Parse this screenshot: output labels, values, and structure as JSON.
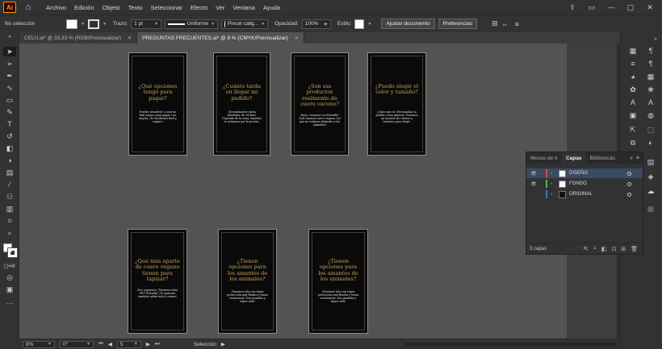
{
  "app": {
    "logo": "Ai",
    "home_icon": "home-icon"
  },
  "menu": [
    "Archivo",
    "Edición",
    "Objeto",
    "Texto",
    "Seleccionar",
    "Efecto",
    "Ver",
    "Ventana",
    "Ayuda"
  ],
  "control_bar": {
    "selection_status": "No selección",
    "stroke_label": "Trazo:",
    "stroke_weight": "1 pt",
    "stroke_profile": "Uniforme",
    "brush": "Pincel calig...",
    "opacity_label": "Opacidad:",
    "opacity_value": "100%",
    "style_label": "Estilo:",
    "adjust_doc_button": "Ajustar documento",
    "preferences_button": "Preferencias"
  },
  "tabs": [
    {
      "label": "CELU.ai* @ 33,33 % (RGB/Previsualizar)",
      "active": false
    },
    {
      "label": "PREGUNTAS FRECUENTES.ai* @ 8 % (CMYK/Previsualizar)",
      "active": true
    }
  ],
  "artboards": [
    {
      "question": "¿Qué opciones tengo para pagar?",
      "answer": "Puedes transferir o usar un link seguro para pagar con tarjeta. ¡Es facilísimo fácil y seguro!"
    },
    {
      "question": "¿Cuánto tarda en llegar mi pedido?",
      "answer": "¡Normalmente tarda alrededor de 24 días! Depende de la zona, también te avisamos por la prensa."
    },
    {
      "question": "¿Son sus productos realmente de cuero vacuno?",
      "answer": "Hoyo, tenemos eco-friendly! Solo usamos cuero vegano, así que no estamos dañando a los animales!"
    },
    {
      "question": "¿Puedo elegir el color y tamaño?",
      "answer": "¡Claro que sí! ¡Personaliza tu pedido como quieras! Tenemos un montón de colores y tamaños para elegir."
    },
    {
      "question": "¿Qué más aparte de cuero vegano tienen para tapizar?",
      "answer": "¡Por supuesto! ¡Tenemos telas PET Friendly! ¡Te gustaría también saber más y vemos!"
    },
    {
      "question": "¿Tienen opciones para los amantes de los animales?",
      "answer": "¡Tenemos tela con súper protección anti-fluidos y tenaz resistencia! Dos grandes y súper vida!"
    },
    {
      "question": "¿Tienen opciones para los amantes de los animales?",
      "answer": "¡Tenemos tela con súper protección anti-fluidos y tenaz resistencia! Dos grandes y súper vida!"
    }
  ],
  "layers_panel": {
    "tabs": [
      "Mesas de tr",
      "Capas",
      "Bibliotecas"
    ],
    "active_tab": "Capas",
    "layers": [
      {
        "name": "DISEÑO",
        "color": "#e8464b",
        "visible": true,
        "selected": true
      },
      {
        "name": "FONDO",
        "color": "#4cb855",
        "visible": true,
        "selected": false
      },
      {
        "name": "ORIGINAL",
        "color": "#4a6fd8",
        "visible": false,
        "selected": false
      }
    ],
    "count": "3 capas"
  },
  "status_bar": {
    "zoom": "8%",
    "rotation": "0°",
    "artboard_number": "5",
    "tool_status": "Selección"
  },
  "colors": {
    "accent_gold": "#c9a25a",
    "ui_dark": "#323232",
    "canvas": "#535353"
  }
}
